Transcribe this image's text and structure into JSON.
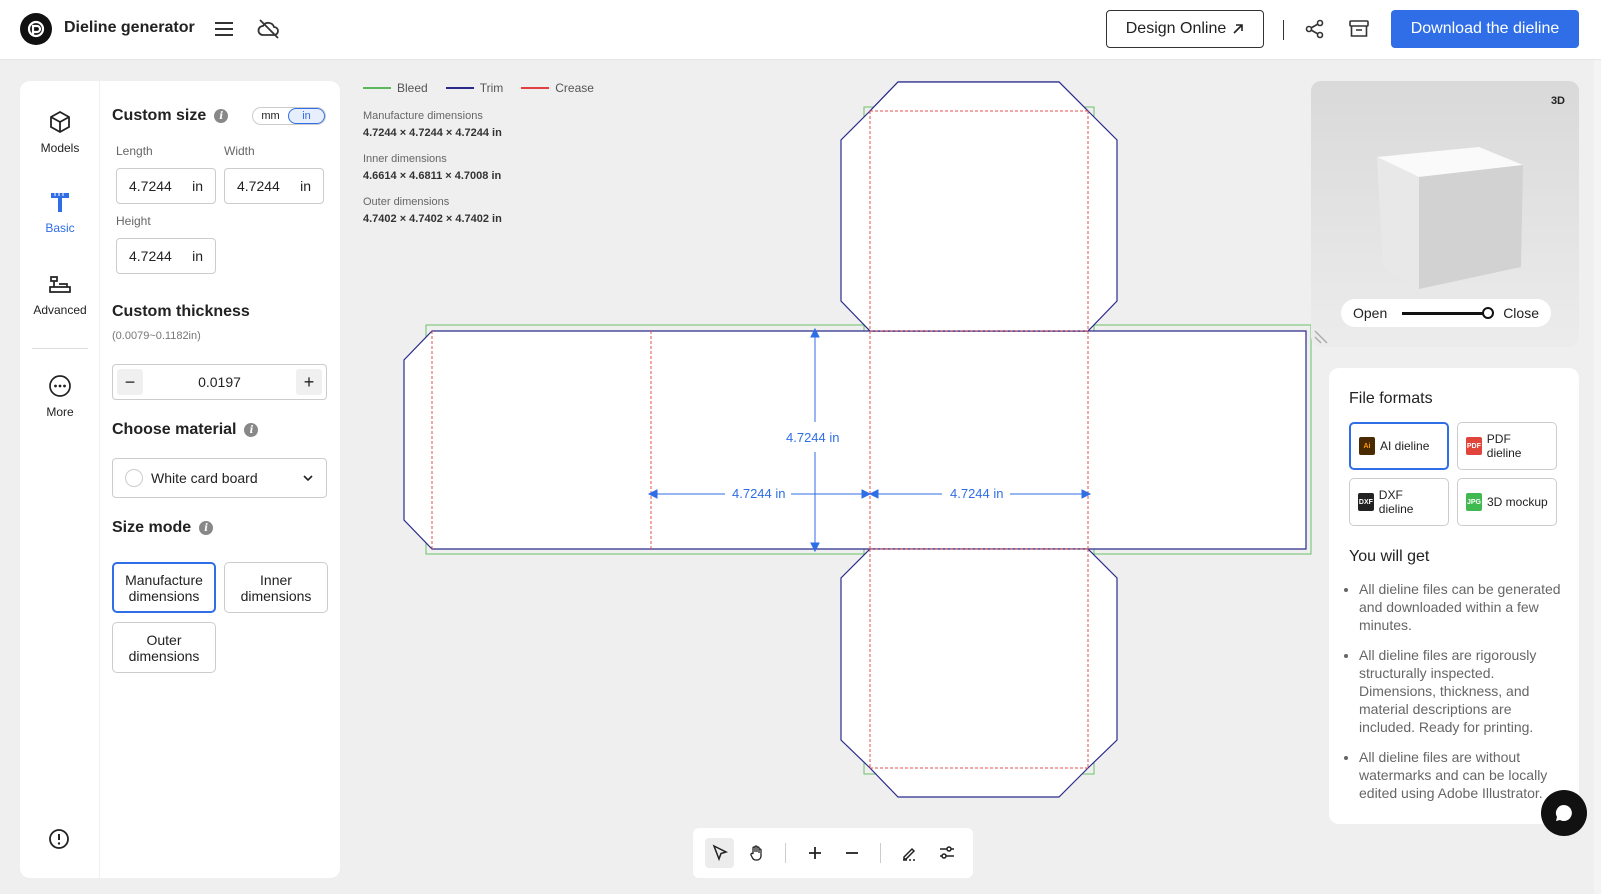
{
  "header": {
    "app_title": "Dieline generator",
    "design_online_label": "Design Online",
    "download_label": "Download the dieline",
    "icons": [
      "menu-icon",
      "cloud-off-icon",
      "share-icon",
      "box-icon"
    ]
  },
  "nav": {
    "items": [
      {
        "label": "Models",
        "icon": "cube-icon"
      },
      {
        "label": "Basic",
        "icon": "ruler-icon"
      },
      {
        "label": "Advanced",
        "icon": "tools-icon"
      },
      {
        "label": "More",
        "icon": "more-icon"
      }
    ]
  },
  "form": {
    "custom_size_title": "Custom size",
    "unit_mm": "mm",
    "unit_in": "in",
    "length_label": "Length",
    "length_value": "4.7244",
    "width_label": "Width",
    "width_value": "4.7244",
    "height_label": "Height",
    "height_value": "4.7244",
    "unit": "in",
    "thickness_title": "Custom thickness",
    "thickness_hint": "(0.0079~0.1182in)",
    "thickness_value": "0.0197",
    "material_title": "Choose material",
    "material_value": "White card board",
    "size_mode_title": "Size mode",
    "modes": [
      "Manufacture dimensions",
      "Inner dimensions",
      "Outer dimensions"
    ]
  },
  "canvas": {
    "legend": [
      {
        "label": "Bleed",
        "color": "#5cb85c"
      },
      {
        "label": "Trim",
        "color": "#2a2a8c"
      },
      {
        "label": "Crease",
        "color": "#e04040"
      }
    ],
    "dims": [
      {
        "label": "Manufacture dimensions",
        "value": "4.7244 × 4.7244 × 4.7244 in"
      },
      {
        "label": "Inner dimensions",
        "value": "4.6614 × 4.6811 × 4.7008 in"
      },
      {
        "label": "Outer dimensions",
        "value": "4.7402 × 4.7402 × 4.7402 in"
      }
    ],
    "measure_label": "4.7244 in",
    "measure_color": "#2f6ee6"
  },
  "preview": {
    "badge": "3D",
    "open_label": "Open",
    "close_label": "Close",
    "slider_value": 1.0
  },
  "files": {
    "title": "File formats",
    "formats": [
      {
        "label": "AI dieline",
        "badge": "Ai",
        "color": "#4a2a00"
      },
      {
        "label": "PDF dieline",
        "badge": "PDF",
        "color": "#e0443a"
      },
      {
        "label": "DXF dieline",
        "badge": "DXF",
        "color": "#222222"
      },
      {
        "label": "3D mockup",
        "badge": "JPG",
        "color": "#3fb950"
      }
    ],
    "you_get_title": "You will get",
    "benefits": [
      "All dieline files can be generated and downloaded within a few minutes.",
      "All dieline files are rigorously structurally inspected. Dimensions, thickness, and material descriptions are included. Ready for printing.",
      "All dieline files are without watermarks and can be locally edited using Adobe Illustrator."
    ]
  }
}
